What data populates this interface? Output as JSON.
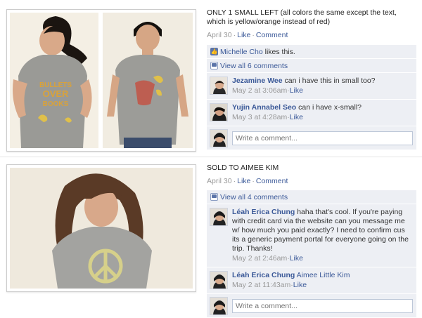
{
  "posts": [
    {
      "caption": "ONLY 1 SMALL LEFT (all colors the same except the text, which is yellow/orange instead of red)",
      "date": "April 30",
      "like_label": "Like",
      "comment_label": "Comment",
      "likes": {
        "name": "Michelle Cho",
        "text": "likes this."
      },
      "view_all": "View all 6 comments",
      "comments": [
        {
          "author": "Jezamine Wee",
          "text": "can i have this in small too?",
          "time": "May 2 at 3:06am",
          "like": "Like"
        },
        {
          "author": "Yujin Annabel Seo",
          "text": "can i have x-small?",
          "time": "May 3 at 4:28am",
          "like": "Like"
        }
      ],
      "write_placeholder": "Write a comment...",
      "shirt_print": [
        "BULLETS",
        "OVER",
        "BOOKS"
      ]
    },
    {
      "caption": "SOLD TO AIMEE KIM",
      "date": "April 30",
      "like_label": "Like",
      "comment_label": "Comment",
      "view_all": "View all 4 comments",
      "comments": [
        {
          "author": "Léah Erica Chung",
          "text": "haha that's cool. If you're paying with credit card via the website can you message me w/ how much you paid exactly? I need to confirm cus its a generic payment portal for everyone going on the trip. Thanks!",
          "time": "May 2 at 2:46am",
          "like": "Like"
        },
        {
          "author": "Léah Erica Chung",
          "text": "Aimee Little Kim",
          "time": "May 2 at 11:43am",
          "like": "Like"
        }
      ],
      "write_placeholder": "Write a comment..."
    }
  ],
  "colors": {
    "link": "#3b5998",
    "panel": "#edeff4",
    "muted": "#999999"
  }
}
